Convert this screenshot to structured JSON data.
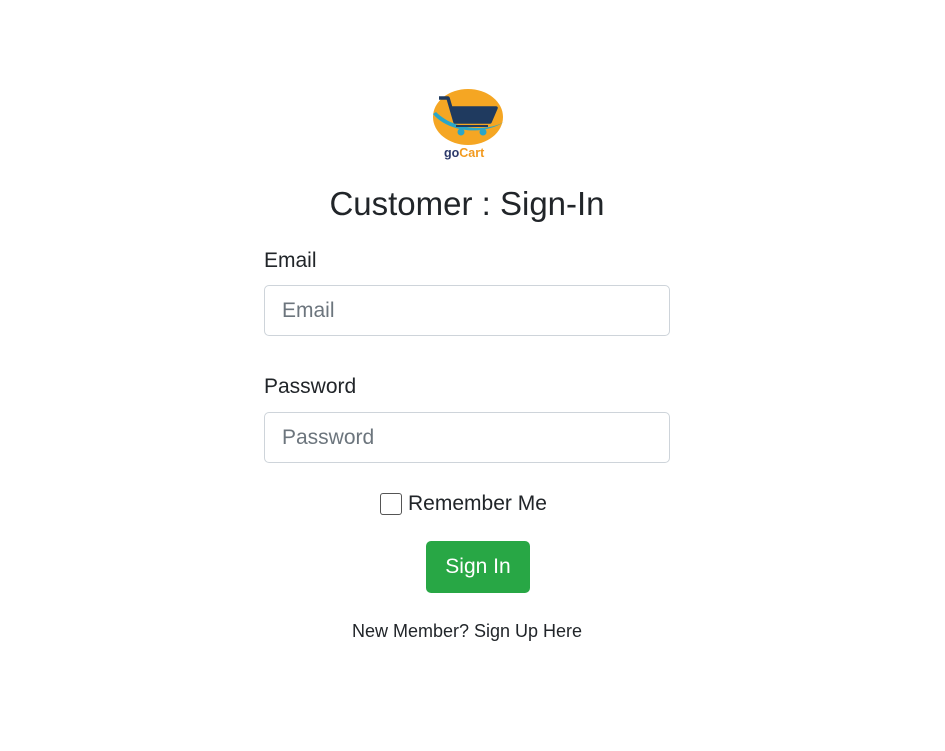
{
  "logo": {
    "text": "goCart",
    "icon": "shopping-cart-logo-icon",
    "colors": {
      "circle": "#f5a623",
      "cart": "#1f3a5f",
      "swoosh": "#2aa6c9",
      "text_go": "#2d3a6b",
      "text_cart": "#f29a1f"
    }
  },
  "page_title": "Customer : Sign-In",
  "form": {
    "email": {
      "label": "Email",
      "placeholder": "Email",
      "value": ""
    },
    "password": {
      "label": "Password",
      "placeholder": "Password",
      "value": ""
    },
    "remember": {
      "label": "Remember Me",
      "checked": false
    },
    "submit_label": "Sign In"
  },
  "signup_link": "New Member? Sign Up Here",
  "colors": {
    "primary_button": "#28a745",
    "input_border": "#ced4da",
    "text": "#212529",
    "placeholder": "#6c757d"
  }
}
